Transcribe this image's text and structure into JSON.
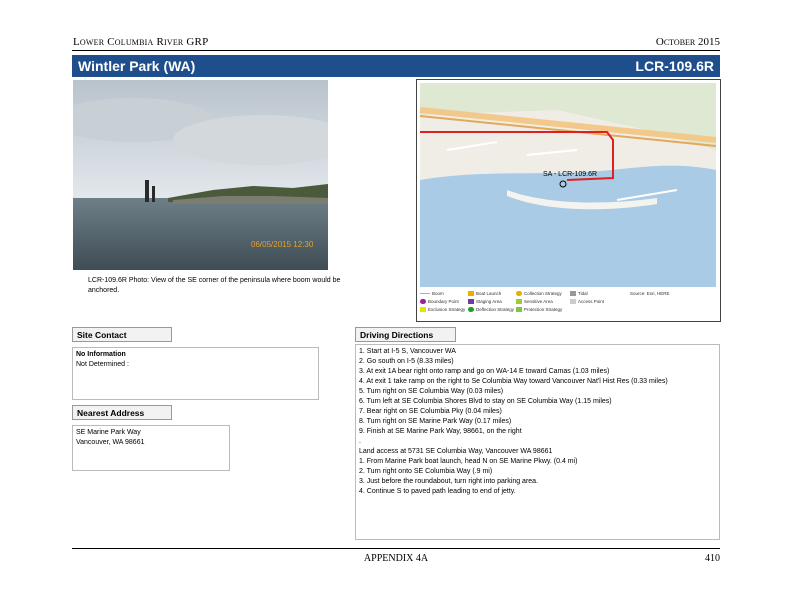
{
  "header": {
    "left": "Lower Columbia River GRP",
    "right": "October 2015"
  },
  "title": {
    "name": "Wintler Park (WA)",
    "code": "LCR-109.6R"
  },
  "photo": {
    "stamp": "06/05/2015 12:30",
    "caption": "LCR-109.6R Photo: View of the SE corner of the peninsula where boom would be anchored."
  },
  "map": {
    "site_label": "SA - LCR-109.6R",
    "legend": [
      {
        "label": "Boom",
        "icon": "line-legend-icon"
      },
      {
        "label": "Boat Launch",
        "icon": "triangle-legend-icon"
      },
      {
        "label": "Collection Strategy",
        "icon": "circle-legend-icon"
      },
      {
        "label": "Staging Area",
        "icon": "diamond-legend-icon"
      },
      {
        "label": "Sensitive Area",
        "icon": "square-legend-icon"
      },
      {
        "label": "Exclusion Strategy",
        "icon": "star-legend-icon"
      },
      {
        "label": "Access Point",
        "icon": "square-legend-icon"
      },
      {
        "label": "Tidal",
        "icon": "arrow-legend-icon"
      },
      {
        "label": "Boundary Point",
        "icon": "circle-legend-icon"
      },
      {
        "label": "Deflection Strategy",
        "icon": "circle-legend-icon"
      },
      {
        "label": "Protection Strategy",
        "icon": "square-legend-icon"
      },
      {
        "label": "Source: Esri, HERE",
        "icon": ""
      }
    ]
  },
  "site_contact": {
    "header": "Site Contact",
    "lines": [
      "No Information",
      "Not Determined :"
    ]
  },
  "nearest_address": {
    "header": "Nearest Address",
    "lines": [
      "SE Marine Park Way",
      "Vancouver, WA 98661"
    ]
  },
  "driving_directions": {
    "header": "Driving Directions",
    "lines": [
      "1. Start at I-5 S, Vancouver WA",
      "2. Go south on I-5 (8.33 miles)",
      "3. At exit 1A bear right onto ramp and go on WA-14 E toward Camas (1.03 miles)",
      "4. At exit 1 take ramp on the right to Se Columbia Way toward Vancouver Nat'l Hist Res (0.33 miles)",
      "5. Turn right on SE Columbia Way (0.03 miles)",
      "6. Turn left at SE Columbia Shores Blvd to stay on SE Columbia Way (1.15 miles)",
      "7. Bear right on SE Columbia Pky (0.04 miles)",
      "8. Turn right on SE Marine Park Way (0.17 miles)",
      "9. Finish at SE Marine Park Way, 98661, on the right",
      ".",
      "Land access at 5731 SE Columbia Way, Vancouver WA 98661",
      "1. From Marine Park boat launch, head N on SE Marine Pkwy. (0.4 mi)",
      "2. Turn right onto SE Columbia Way (.9 mi)",
      "3. Just before the roundabout, turn right into parking area.",
      "4. Continue S to paved path leading to end of jetty."
    ]
  },
  "footer": {
    "center": "Appendix 4A",
    "page": "410"
  }
}
